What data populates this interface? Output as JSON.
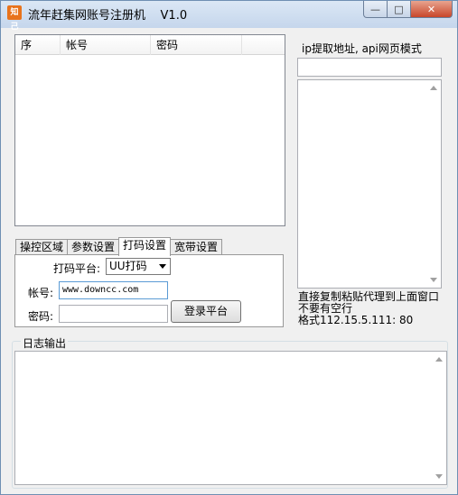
{
  "window": {
    "title": "流年赶集网账号注册机    V1.0",
    "icon_text": "知己",
    "min_symbol": "—",
    "max_symbol": "□",
    "close_symbol": "✕"
  },
  "account_list": {
    "columns": [
      "序",
      "帐号",
      "密码"
    ]
  },
  "proxy": {
    "label": "ip提取地址, api网页模式",
    "url_value": "",
    "list_value": "",
    "hint_line1": "直接复制粘贴代理到上面窗口",
    "hint_line2": "不要有空行",
    "hint_line3": "格式112.15.5.111: 80"
  },
  "tabs": [
    "操控区域",
    "参数设置",
    "打码设置",
    "宽带设置"
  ],
  "active_tab": "打码设置",
  "captcha": {
    "platform_label": "打码平台:",
    "platform_value": "UU打码",
    "account_label": "帐号:",
    "account_value": "www.downcc.com",
    "password_label": "密码:",
    "password_value": "",
    "login_button": "登录平台"
  },
  "log": {
    "title": "日志输出",
    "content": ""
  }
}
